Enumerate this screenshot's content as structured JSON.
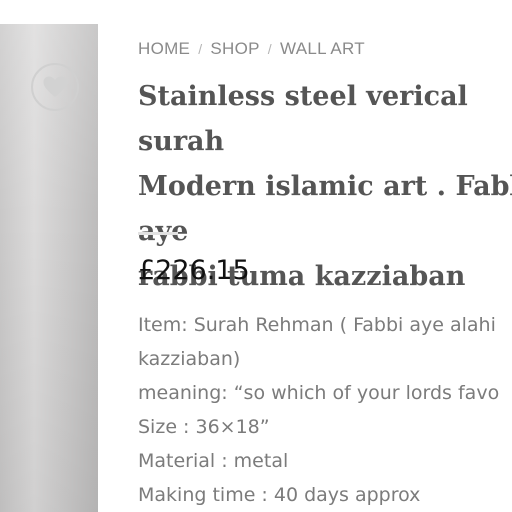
{
  "breadcrumb": {
    "items": [
      "HOME",
      "SHOP",
      "WALL ART"
    ],
    "separator": "/"
  },
  "product": {
    "title": "Stainless steel verical surah\nModern islamic art . Fabbi aye\nrabbi tuma kazziaban",
    "price": "£226.15",
    "description_lines": [
      "Item: Surah Rehman ( Fabbi aye alahi",
      "kazziaban)",
      "meaning: “so which of your lords favo",
      "Size : 36×18”",
      "Material : metal",
      "Making time : 40 days approx"
    ]
  },
  "icons": {
    "wishlist": "heart-icon",
    "gallery_next": "chevron-right-icon"
  },
  "colors": {
    "breadcrumb": "#8a8a8a",
    "title": "#555555",
    "price": "#111111",
    "description": "#7b7b7b"
  }
}
